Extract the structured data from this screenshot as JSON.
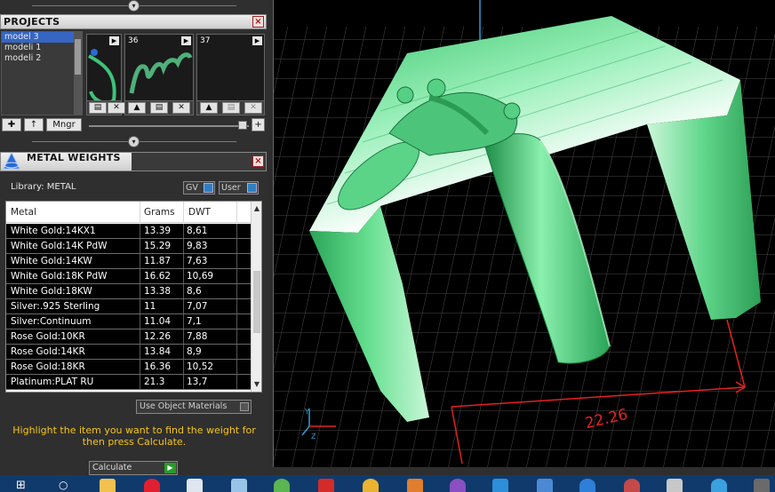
{
  "projects_panel": {
    "title": "PROJECTS",
    "list": [
      "model 3",
      "modeli 1",
      "modeli 2"
    ],
    "selected_index": 0,
    "thumbnails": [
      {
        "number": ""
      },
      {
        "number": "36"
      },
      {
        "number": "37"
      }
    ],
    "manager_button": "Mngr"
  },
  "metal_weights": {
    "title": "METAL WEIGHTS",
    "library_label": "Library: METAL",
    "gv_toggle": "GV",
    "user_toggle": "User",
    "columns": [
      "Metal",
      "Grams",
      "DWT"
    ],
    "rows": [
      {
        "metal": "White Gold:14KX1",
        "grams": "13.39",
        "dwt": "8,61"
      },
      {
        "metal": "White Gold:14K PdW",
        "grams": "15.29",
        "dwt": "9,83"
      },
      {
        "metal": "White Gold:14KW",
        "grams": "11.87",
        "dwt": "7,63"
      },
      {
        "metal": "White Gold:18K PdW",
        "grams": "16.62",
        "dwt": "10,69"
      },
      {
        "metal": "White Gold:18KW",
        "grams": "13.38",
        "dwt": "8,6"
      },
      {
        "metal": "Silver:.925 Sterling",
        "grams": "11",
        "dwt": "7,07"
      },
      {
        "metal": "Silver:Continuum",
        "grams": "11.04",
        "dwt": "7,1"
      },
      {
        "metal": "Rose Gold:10KR",
        "grams": "12.26",
        "dwt": "7,88"
      },
      {
        "metal": "Rose Gold:14KR",
        "grams": "13.84",
        "dwt": "8,9"
      },
      {
        "metal": "Rose Gold:18KR",
        "grams": "16.36",
        "dwt": "10,52"
      },
      {
        "metal": "Platinum:PLAT RU",
        "grams": "21.3",
        "dwt": "13,7"
      }
    ],
    "use_object_materials": "Use Object Materials",
    "hint": "Highlight the item you want to find the weight for then press Calculate.",
    "calculate_button": "Calculate"
  },
  "viewport": {
    "dimension_value": "22.26",
    "axis_labels": {
      "y": "Y",
      "z": "Z"
    },
    "model_color": "#3fd276",
    "dimension_color": "#e52020",
    "grid_color": "#4a4a4a"
  },
  "taskbar": {
    "icons": [
      "windows-start-icon",
      "search-icon",
      "file-explorer-icon",
      "opera-icon",
      "pinned-app-icon-1",
      "pinned-app-icon-2",
      "utorrent-icon",
      "pinned-app-icon-3",
      "chrome-icon",
      "pinned-app-icon-4",
      "pinned-app-icon-5",
      "pinned-app-icon-6",
      "pinned-app-icon-7",
      "pinned-app-icon-8",
      "pinned-app-icon-9",
      "pinned-app-icon-10",
      "pinned-app-icon-11",
      "pinned-app-icon-12"
    ],
    "color": "#103a6b"
  }
}
